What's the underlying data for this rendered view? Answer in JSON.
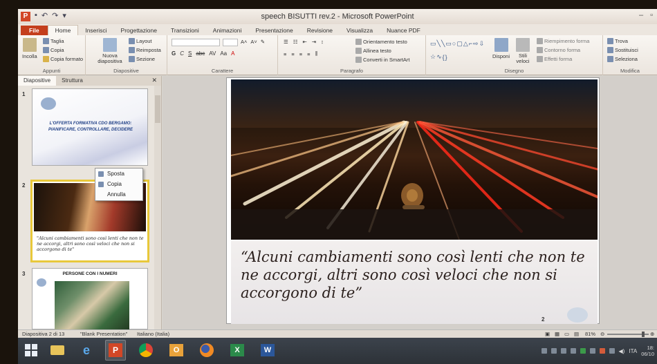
{
  "window": {
    "title": "speech BISUTTI rev.2 - Microsoft PowerPoint",
    "app_icon": "P"
  },
  "ribbon_tabs": [
    "File",
    "Home",
    "Inserisci",
    "Progettazione",
    "Transizioni",
    "Animazioni",
    "Presentazione",
    "Revisione",
    "Visualizza",
    "Nuance PDF"
  ],
  "ribbon": {
    "clipboard": {
      "paste": "Incolla",
      "cut": "Taglia",
      "copy": "Copia",
      "format_painter": "Copia formato",
      "label": "Appunti"
    },
    "slides": {
      "new_slide": "Nuova diapositiva",
      "layout": "Layout",
      "reset": "Reimposta",
      "section": "Sezione",
      "label": "Diapositive"
    },
    "font": {
      "label": "Carattere",
      "buttons": [
        "G",
        "C",
        "S",
        "abc",
        "AV",
        "Aa",
        "A"
      ]
    },
    "paragraph": {
      "label": "Paragrafo",
      "text_direction": "Orientamento testo",
      "align_text": "Allinea testo",
      "convert_smartart": "Converti in SmartArt"
    },
    "drawing": {
      "label": "Disegno",
      "arrange": "Disponi",
      "quick_styles": "Stili veloci",
      "shape_fill": "Riempimento forma",
      "shape_outline": "Contorno forma",
      "shape_effects": "Effetti forma"
    },
    "editing": {
      "label": "Modifica",
      "find": "Trova",
      "replace": "Sostituisci",
      "select": "Seleziona"
    }
  },
  "pane": {
    "tabs": [
      "Diapositive",
      "Struttura"
    ],
    "slides": [
      {
        "num": "1",
        "title": "L'OFFERTA FORMATIVA CDO BERGAMO:",
        "subtitle": "PIANIFICARE, CONTROLLARE, DECIDERE"
      },
      {
        "num": "2",
        "quote": "\"Alcuni cambiamenti sono così lenti che non te ne accorgi, altri sono così veloci che non si accorgono di te\""
      },
      {
        "num": "3",
        "title": "PERSONE CON I NUMERI"
      }
    ]
  },
  "context_menu": [
    "Sposta",
    "Copia",
    "Annulla"
  ],
  "main_slide": {
    "quote": "“Alcuni cambiamenti sono così lenti che non te ne accorgi, altri sono così veloci che non si accorgono di te”",
    "number": "2"
  },
  "status_bar": {
    "slide_info": "Diapositiva 2 di 13",
    "theme": "\"Blank Presentation\"",
    "language": "Italiano (Italia)",
    "zoom": "81%",
    "zoom_level": 0.81
  },
  "taskbar": {
    "apps": [
      "start",
      "file-explorer",
      "internet-explorer",
      "powerpoint",
      "chrome",
      "outlook",
      "firefox",
      "excel",
      "word"
    ],
    "language": "ITA",
    "clock_time": "18:",
    "clock_date": "06/10"
  },
  "colors": {
    "file_tab": "#c43e1c",
    "selection": "#e8c83a",
    "taskbar": "#2d3238"
  }
}
